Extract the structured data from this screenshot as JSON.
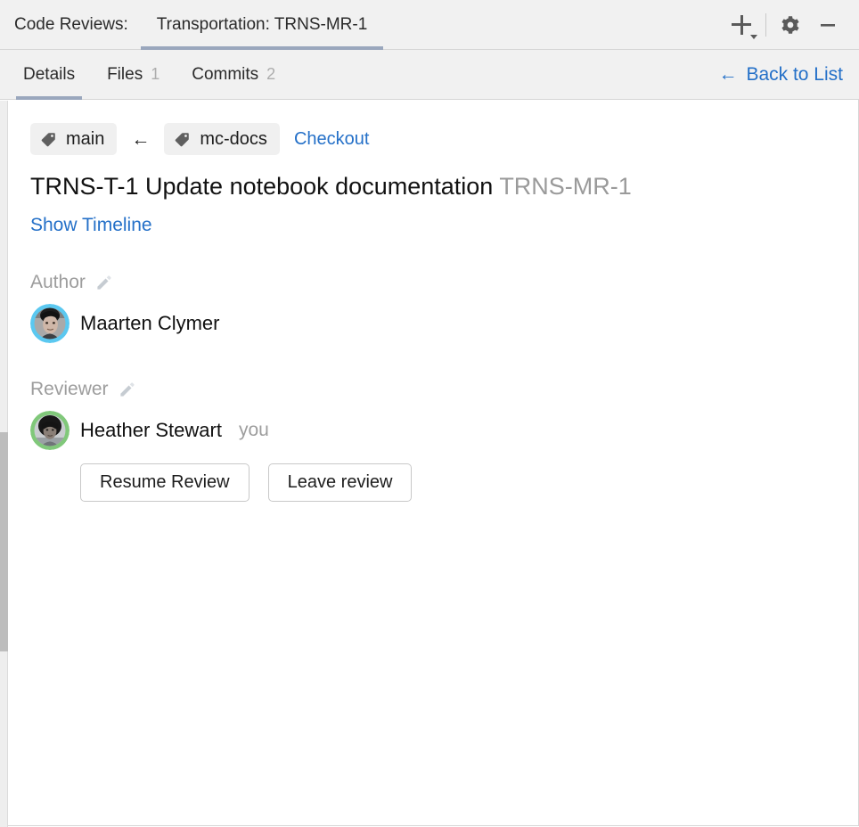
{
  "window": {
    "label": "Code Reviews:",
    "tab_title": "Transportation: TRNS-MR-1",
    "actions": {
      "add": "add-with-dropdown",
      "settings": "gear-icon",
      "minimize": "minimize-icon"
    }
  },
  "tabs": [
    {
      "label": "Details",
      "count": "",
      "active": true
    },
    {
      "label": "Files",
      "count": "1",
      "active": false
    },
    {
      "label": "Commits",
      "count": "2",
      "active": false
    }
  ],
  "back_link": {
    "arrow": "←",
    "label": "Back to List"
  },
  "branches": {
    "target": "main",
    "arrow": "←",
    "source": "mc-docs",
    "checkout_label": "Checkout"
  },
  "review": {
    "title": "TRNS-T-1 Update notebook documentation",
    "id": "TRNS-MR-1",
    "timeline_link": "Show Timeline"
  },
  "author": {
    "label": "Author",
    "name": "Maarten Clymer",
    "ring_color": "#5bc8f0"
  },
  "reviewer": {
    "label": "Reviewer",
    "name": "Heather Stewart",
    "you_label": "you",
    "ring_color": "#80c87a",
    "buttons": [
      {
        "label": "Resume Review"
      },
      {
        "label": "Leave review"
      }
    ]
  },
  "theme": {
    "link_blue": "#2470c8",
    "tab_underline": "#9aa7bd",
    "header_bg": "#f1f1f1",
    "muted_text": "#9d9d9d"
  }
}
